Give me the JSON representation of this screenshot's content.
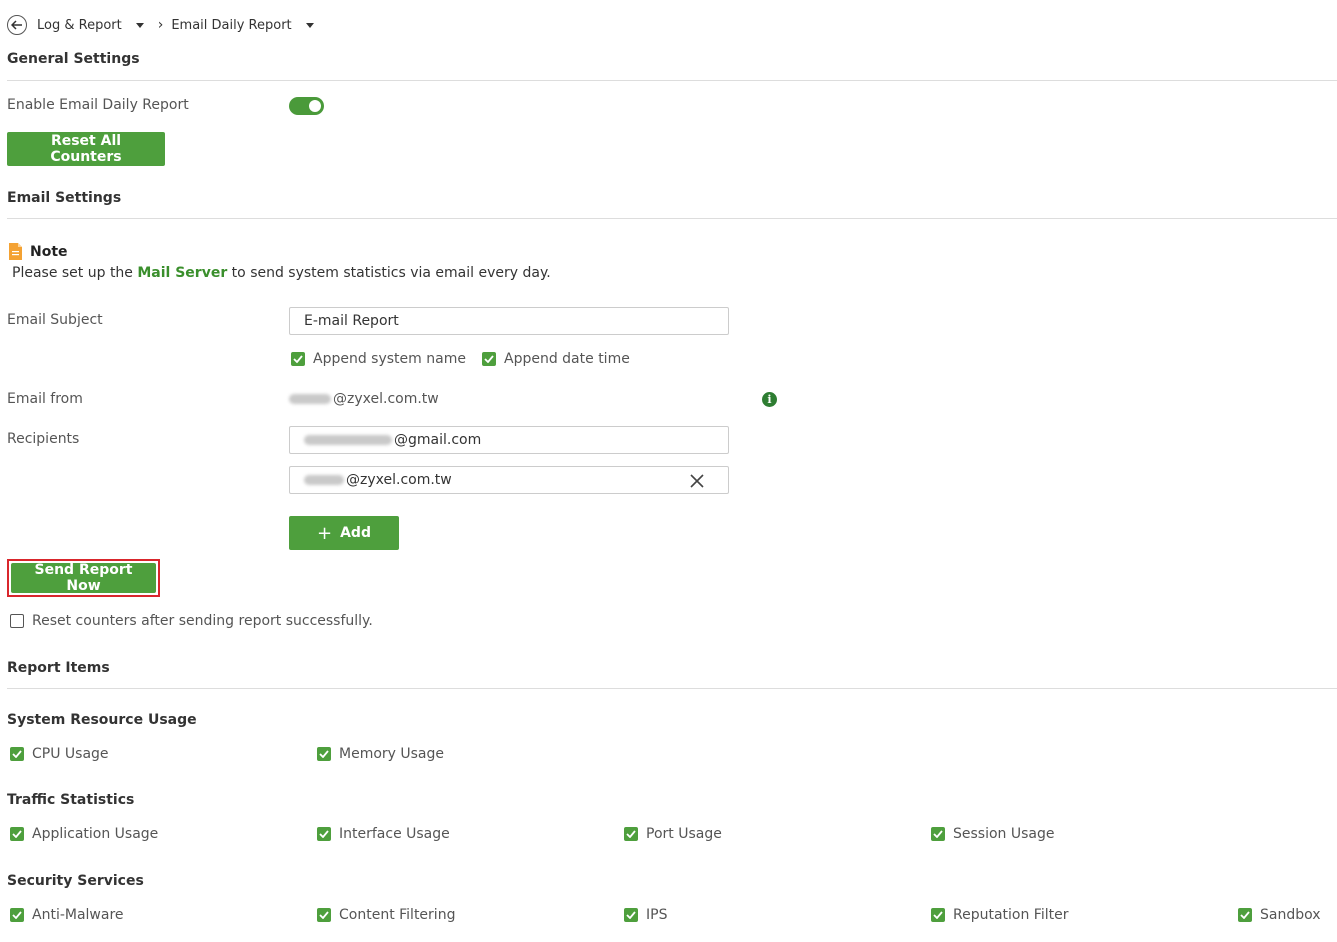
{
  "breadcrumb": {
    "item1": "Log & Report",
    "item2": "Email Daily Report"
  },
  "general": {
    "title": "General Settings",
    "enable_label": "Enable Email Daily Report",
    "enabled": true,
    "reset_button": "Reset All Counters"
  },
  "email": {
    "title": "Email Settings",
    "note_title": "Note",
    "note_prefix": "Please set up the ",
    "note_link": "Mail Server",
    "note_suffix": " to send system statistics via email every day.",
    "subject_label": "Email Subject",
    "subject_value": "E-mail Report",
    "append_system_name": "Append system name",
    "append_date_time": "Append date time",
    "from_label": "Email from",
    "from_value": "@zyxel.com.tw",
    "recipients_label": "Recipients",
    "recipient1": "@gmail.com",
    "recipient2": "@zyxel.com.tw",
    "add_button": "Add",
    "send_button": "Send Report Now",
    "reset_after_label": "Reset counters after sending report successfully."
  },
  "report": {
    "title": "Report Items",
    "system": {
      "title": "System Resource Usage",
      "items": [
        "CPU Usage",
        "Memory Usage"
      ]
    },
    "traffic": {
      "title": "Traffic Statistics",
      "items": [
        "Application Usage",
        "Interface Usage",
        "Port Usage",
        "Session Usage"
      ]
    },
    "security": {
      "title": "Security Services",
      "items": [
        "Anti-Malware",
        "Content Filtering",
        "IPS",
        "Reputation Filter",
        "Sandbox"
      ]
    }
  },
  "colors": {
    "accent": "#4e9f3d",
    "highlight_border": "#d9262c"
  }
}
